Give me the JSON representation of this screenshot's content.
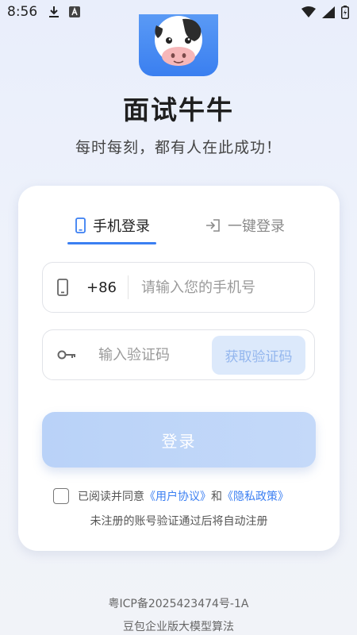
{
  "status_bar": {
    "time": "8:56",
    "icons_left": [
      "download-icon",
      "app-notification-icon"
    ],
    "icons_right": [
      "wifi-icon",
      "signal-icon",
      "battery-icon"
    ]
  },
  "app": {
    "title": "面试牛牛",
    "slogan": "每时每刻，都有人在此成功！",
    "logo_icon": "cow-logo-icon",
    "brand_color": "#3b7ff2"
  },
  "tabs": [
    {
      "label": "手机登录",
      "icon": "phone-icon",
      "active": true
    },
    {
      "label": "一键登录",
      "icon": "login-arrow-icon",
      "active": false
    }
  ],
  "phone_field": {
    "icon": "phone-icon",
    "country_code": "+86",
    "placeholder": "请输入您的手机号",
    "value": ""
  },
  "code_field": {
    "icon": "key-icon",
    "placeholder": "输入验证码",
    "value": "",
    "get_code_label": "获取验证码"
  },
  "login_button": {
    "label": "登录"
  },
  "agreement": {
    "checked": false,
    "prefix": "已阅读并同意",
    "user_agreement": "《用户协议》",
    "conjunction": "和",
    "privacy_policy": "《隐私政策》"
  },
  "notice": "未注册的账号验证通过后将自动注册",
  "footer": {
    "icp": "粤ICP备2025423474号-1A",
    "algorithm": "豆包企业版大模型算法"
  }
}
